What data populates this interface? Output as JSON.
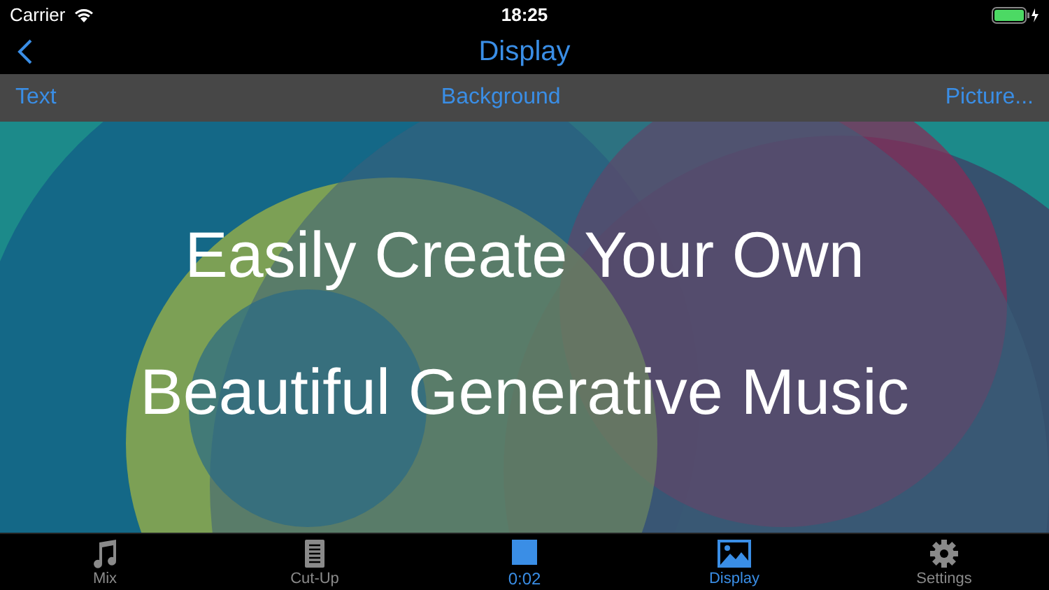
{
  "status_bar": {
    "carrier": "Carrier",
    "time": "18:25"
  },
  "nav": {
    "title": "Display"
  },
  "toolbar": [
    "Text",
    "Background",
    "Picture..."
  ],
  "headline": [
    "Easily Create Your Own",
    "Beautiful Generative Music"
  ],
  "tabs": [
    {
      "label": "Mix",
      "kind": "music",
      "selected": false
    },
    {
      "label": "Cut-Up",
      "kind": "document",
      "selected": false
    },
    {
      "label": "Display",
      "kind": "picture",
      "selected": true
    },
    {
      "label": "Settings",
      "kind": "gear",
      "selected": false
    }
  ],
  "player": {
    "time": "0:02"
  }
}
